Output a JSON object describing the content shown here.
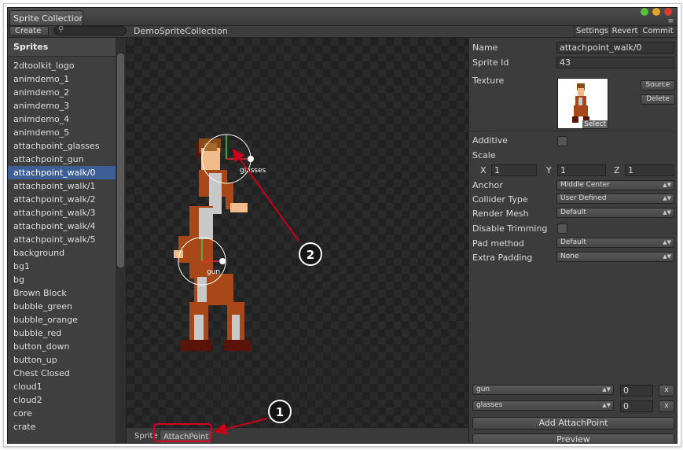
{
  "window": {
    "tab_title": "Sprite Collection",
    "traffic_colors": [
      "#5dbf3e",
      "#e7a22a",
      "#de3b33"
    ]
  },
  "toolbar": {
    "create_label": "Create",
    "collection_name": "DemoSpriteCollection",
    "settings_label": "Settings",
    "revert_label": "Revert",
    "commit_label": "Commit"
  },
  "sidebar": {
    "header": "Sprites",
    "items": [
      "2dtoolkit_logo",
      "animdemo_1",
      "animdemo_2",
      "animdemo_3",
      "animdemo_4",
      "animdemo_5",
      "attachpoint_glasses",
      "attachpoint_gun",
      "attachpoint_walk/0",
      "attachpoint_walk/1",
      "attachpoint_walk/2",
      "attachpoint_walk/3",
      "attachpoint_walk/4",
      "attachpoint_walk/5",
      "background",
      "bg1",
      "bg",
      "Brown Block",
      "bubble_green",
      "bubble_orange",
      "bubble_red",
      "button_down",
      "button_up",
      "Chest Closed",
      "cloud1",
      "cloud2",
      "core",
      "crate"
    ],
    "selected_index": 8
  },
  "canvas": {
    "attach_label_glasses": "glasses",
    "attach_label_gun": "gun"
  },
  "canvas_tabs": {
    "sprite_tab": "Sprite",
    "attach_tab": "AttachPoint"
  },
  "inspector": {
    "name_label": "Name",
    "name_value": "attachpoint_walk/0",
    "sprite_id_label": "Sprite Id",
    "sprite_id_value": "43",
    "texture_label": "Texture",
    "source_btn": "Source",
    "delete_btn": "Delete",
    "select_label": "Select",
    "additive_label": "Additive",
    "scale_label": "Scale",
    "scale_x_label": "X",
    "scale_x": "1",
    "scale_y_label": "Y",
    "scale_y": "1",
    "scale_z_label": "Z",
    "scale_z": "1",
    "anchor_label": "Anchor",
    "anchor_value": "Middle Center",
    "collider_label": "Collider Type",
    "collider_value": "User Defined",
    "render_mesh_label": "Render Mesh",
    "render_mesh_value": "Default",
    "disable_trim_label": "Disable Trimming",
    "pad_method_label": "Pad method",
    "pad_method_value": "Default",
    "extra_padding_label": "Extra Padding",
    "extra_padding_value": "None",
    "attachpoints": [
      {
        "name": "gun",
        "value": "0",
        "remove": "x"
      },
      {
        "name": "glasses",
        "value": "0",
        "remove": "x"
      }
    ],
    "add_attachpoint_btn": "Add AttachPoint",
    "preview_btn": "Preview"
  },
  "callouts": {
    "one": "1",
    "two": "2"
  },
  "colors": {
    "selection": "#3e5f96",
    "callout_arrow": "#c8001a",
    "attach_circle": "#ffffff"
  }
}
